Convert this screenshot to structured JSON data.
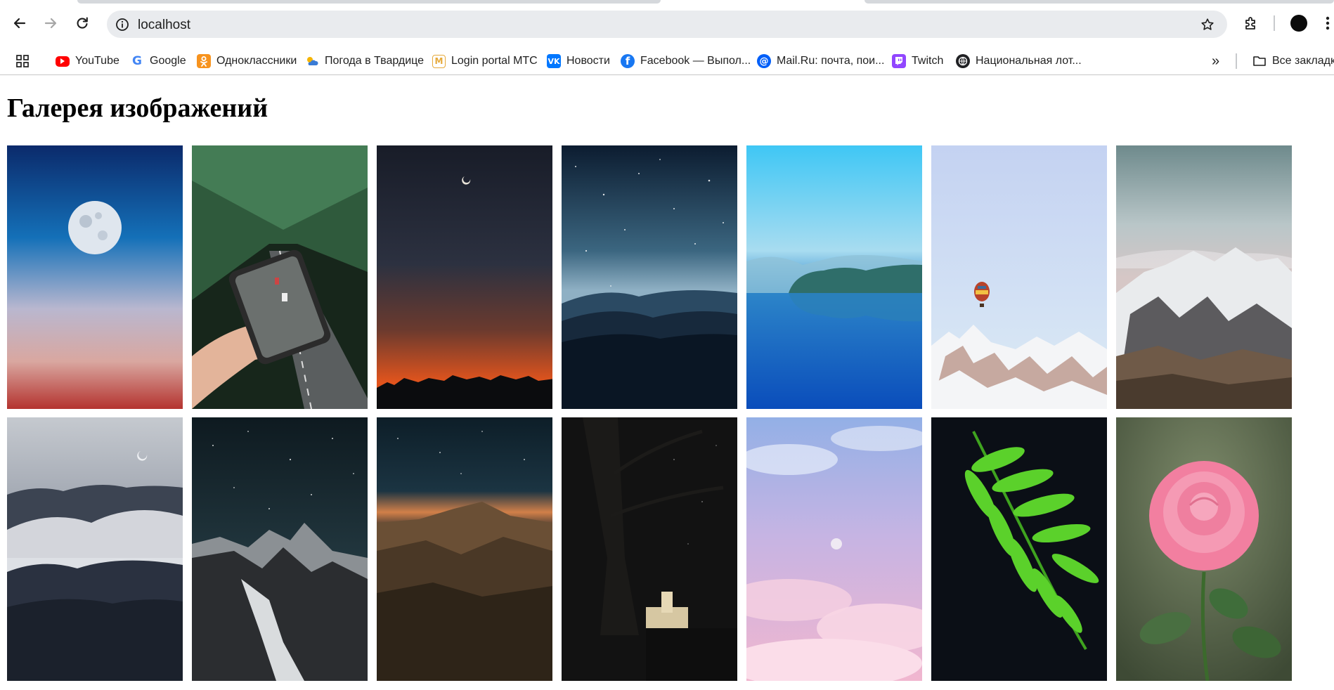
{
  "browser": {
    "address_bar": {
      "url": "localhost"
    },
    "icons": [
      "back-icon",
      "forward-icon",
      "reload-icon",
      "site-info-icon",
      "bookmark-star-icon",
      "extensions-icon",
      "profile-avatar",
      "menu-icon"
    ],
    "bookmarks": [
      {
        "label": "YouTube",
        "icon": "youtube-icon",
        "color": "#ff0000"
      },
      {
        "label": "Google",
        "icon": "google-icon",
        "color": "#4285f4"
      },
      {
        "label": "Одноклассники",
        "icon": "odnoklassniki-icon",
        "color": "#f7931e"
      },
      {
        "label": "Погода в Твардице",
        "icon": "weather-icon",
        "color": "#3a7bd5"
      },
      {
        "label": "Login portal МТС",
        "icon": "mts-icon",
        "color": "#e30611"
      },
      {
        "label": "Новости",
        "icon": "vk-icon",
        "color": "#0077ff"
      },
      {
        "label": "Facebook — Выпол...",
        "icon": "facebook-icon",
        "color": "#1877f2"
      },
      {
        "label": "Mail.Ru: почта, пои...",
        "icon": "mailru-icon",
        "color": "#005ff9"
      },
      {
        "label": "Twitch",
        "icon": "twitch-icon",
        "color": "#9146ff"
      },
      {
        "label": "Национальная лот...",
        "icon": "globe-icon",
        "color": "#202124"
      }
    ],
    "overflow_label": "»",
    "all_bookmarks_label": "Все закладки"
  },
  "page": {
    "title": "Галерея изображений",
    "images": [
      {
        "subject": "full moon over blue-to-orange gradient sky"
      },
      {
        "subject": "hand holding phone showing forest road"
      },
      {
        "subject": "crescent moon over orange sunset horizon"
      },
      {
        "subject": "starry night sky over blue mountains"
      },
      {
        "subject": "blue lake with forested hills"
      },
      {
        "subject": "hot air balloon over snowy peaks"
      },
      {
        "subject": "snow-capped mountain range"
      },
      {
        "subject": "foggy mountain forest with crescent moon"
      },
      {
        "subject": "dark mountain peak under stars"
      },
      {
        "subject": "mountain range at dusk under starry sky"
      },
      {
        "subject": "lit castle beneath dark tree at night"
      },
      {
        "subject": "pink and lilac cloudy sky with moon"
      },
      {
        "subject": "green fern leaf on dark background"
      },
      {
        "subject": "pink rose in bloom"
      }
    ]
  }
}
